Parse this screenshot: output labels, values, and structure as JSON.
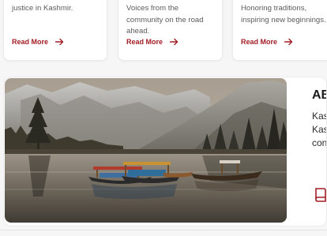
{
  "cards": [
    {
      "text": "justice in Kashmir.",
      "link": "Read More"
    },
    {
      "text": "Voices from the community on the road ahead.",
      "link": "Read More"
    },
    {
      "text": "Honoring traditions, inspiring new beginnings.",
      "link": "Read More"
    }
  ],
  "feature": {
    "image_alt": "Shikara boats on a calm Kashmir lake with mountains and pine trees at dusk",
    "heading": "AB",
    "text": "Kas Kas con to t",
    "icon": "book-icon"
  },
  "colors": {
    "accent": "#a31d25",
    "card_bg": "#ffffff",
    "page_bg": "#f6f6f6"
  }
}
